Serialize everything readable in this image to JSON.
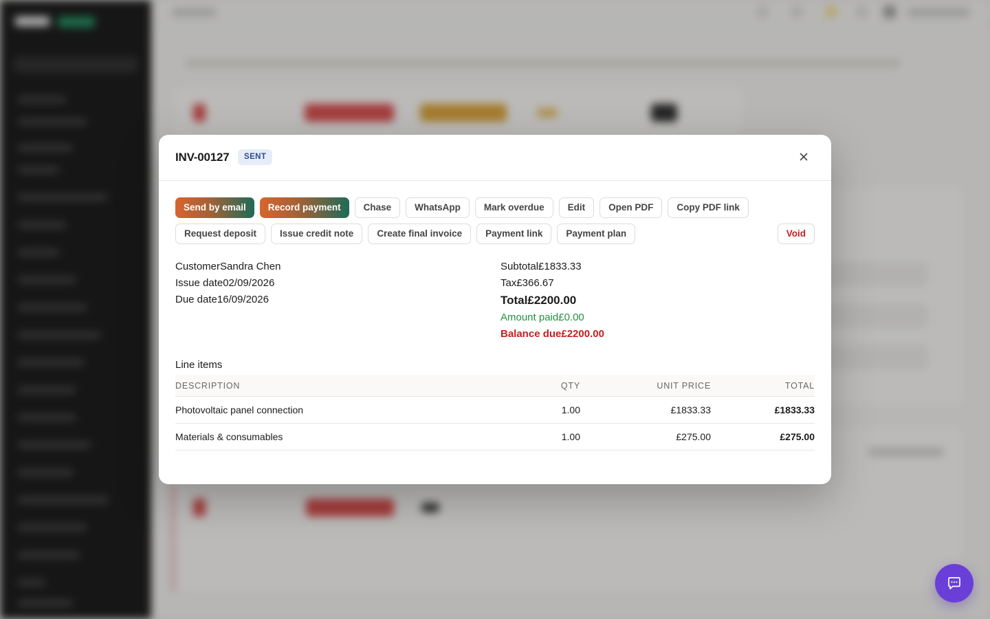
{
  "invoice": {
    "number": "INV-00127",
    "status": "SENT"
  },
  "actions": {
    "row1": [
      "Send by email",
      "Record payment",
      "Chase",
      "WhatsApp",
      "Mark overdue",
      "Edit",
      "Open PDF",
      "Copy PDF link"
    ],
    "row2": [
      "Request deposit",
      "Issue credit note",
      "Create final invoice",
      "Payment link",
      "Payment plan"
    ],
    "void": "Void"
  },
  "details": {
    "customer_label": "Customer",
    "customer": "Sandra Chen",
    "issue_label": "Issue date",
    "issue_date": "02/09/2026",
    "due_label": "Due date",
    "due_date": "16/09/2026"
  },
  "totals": {
    "subtotal_label": "Subtotal",
    "subtotal": "£1833.33",
    "tax_label": "Tax",
    "tax": "£366.67",
    "total_label": "Total",
    "total": "£2200.00",
    "paid_label": "Amount paid",
    "paid": "£0.00",
    "due_label": "Balance due",
    "due": "£2200.00"
  },
  "line_items": {
    "title": "Line items",
    "headers": {
      "description": "DESCRIPTION",
      "qty": "QTY",
      "unit_price": "UNIT PRICE",
      "total": "TOTAL"
    },
    "rows": [
      {
        "description": "Photovoltaic panel connection",
        "qty": "1.00",
        "unit_price": "£1833.33",
        "total": "£1833.33"
      },
      {
        "description": "Materials & consumables",
        "qty": "1.00",
        "unit_price": "£275.00",
        "total": "£275.00"
      }
    ]
  },
  "icons": {
    "close": "close-icon",
    "chat": "chat-icon"
  },
  "colors": {
    "status_badge_bg": "#e6edf9",
    "status_badge_text": "#2d4a8a",
    "paid_green": "#229140",
    "due_red": "#c41f1f",
    "chat_purple": "#6a3fd8"
  }
}
